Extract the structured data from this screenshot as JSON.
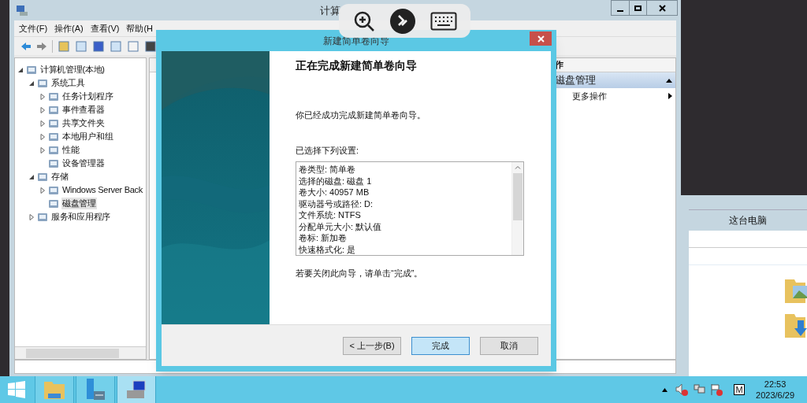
{
  "main_window": {
    "title": "计算",
    "menu": [
      "文件(F)",
      "操作(A)",
      "查看(V)",
      "帮助(H"
    ],
    "tree": [
      {
        "label": "计算机管理(本地)",
        "expanded": true,
        "selected": false,
        "children": [
          {
            "label": "系统工具",
            "expanded": true,
            "selected": false,
            "children": [
              {
                "label": "任务计划程序",
                "expanded": false,
                "selected": false
              },
              {
                "label": "事件查看器",
                "expanded": false,
                "selected": false
              },
              {
                "label": "共享文件夹",
                "expanded": false,
                "selected": false
              },
              {
                "label": "本地用户和组",
                "expanded": false,
                "selected": false
              },
              {
                "label": "性能",
                "expanded": false,
                "selected": false
              },
              {
                "label": "设备管理器",
                "selected": false
              }
            ]
          },
          {
            "label": "存储",
            "expanded": true,
            "selected": false,
            "children": [
              {
                "label": "Windows Server Back",
                "expanded": false,
                "selected": false
              },
              {
                "label": "磁盘管理",
                "selected": true
              }
            ]
          },
          {
            "label": "服务和应用程序",
            "expanded": false,
            "selected": false
          }
        ]
      }
    ],
    "actions": {
      "header": "作",
      "items": [
        {
          "label": "磁盘管理",
          "kind": "section"
        },
        {
          "label": "更多操作",
          "kind": "item"
        }
      ]
    }
  },
  "dialog": {
    "title": "新建简单卷向导",
    "heading": "正在完成新建简单卷向导",
    "intro": "你已经成功完成新建简单卷向导。",
    "settings_label": "已选择下列设置:",
    "settings": [
      "卷类型: 简单卷",
      "选择的磁盘: 磁盘 1",
      "卷大小: 40957 MB",
      "驱动器号或路径: D:",
      "文件系统: NTFS",
      "分配单元大小: 默认值",
      "卷标: 新加卷",
      "快速格式化: 是"
    ],
    "closing": "若要关闭此向导，请单击“完成”。",
    "buttons": [
      {
        "label": "< 上一步(B)",
        "selected": false
      },
      {
        "label": "完成",
        "selected": true
      },
      {
        "label": "取消",
        "selected": false
      }
    ]
  },
  "explorer": {
    "header": "这台电脑"
  },
  "taskbar": {
    "apps": [
      {
        "kind": "explorer",
        "selected": false
      },
      {
        "kind": "server",
        "selected": false
      },
      {
        "kind": "compmgmt",
        "selected": true
      }
    ],
    "ime": "M",
    "time": "22:53",
    "date": "2023/6/29"
  }
}
